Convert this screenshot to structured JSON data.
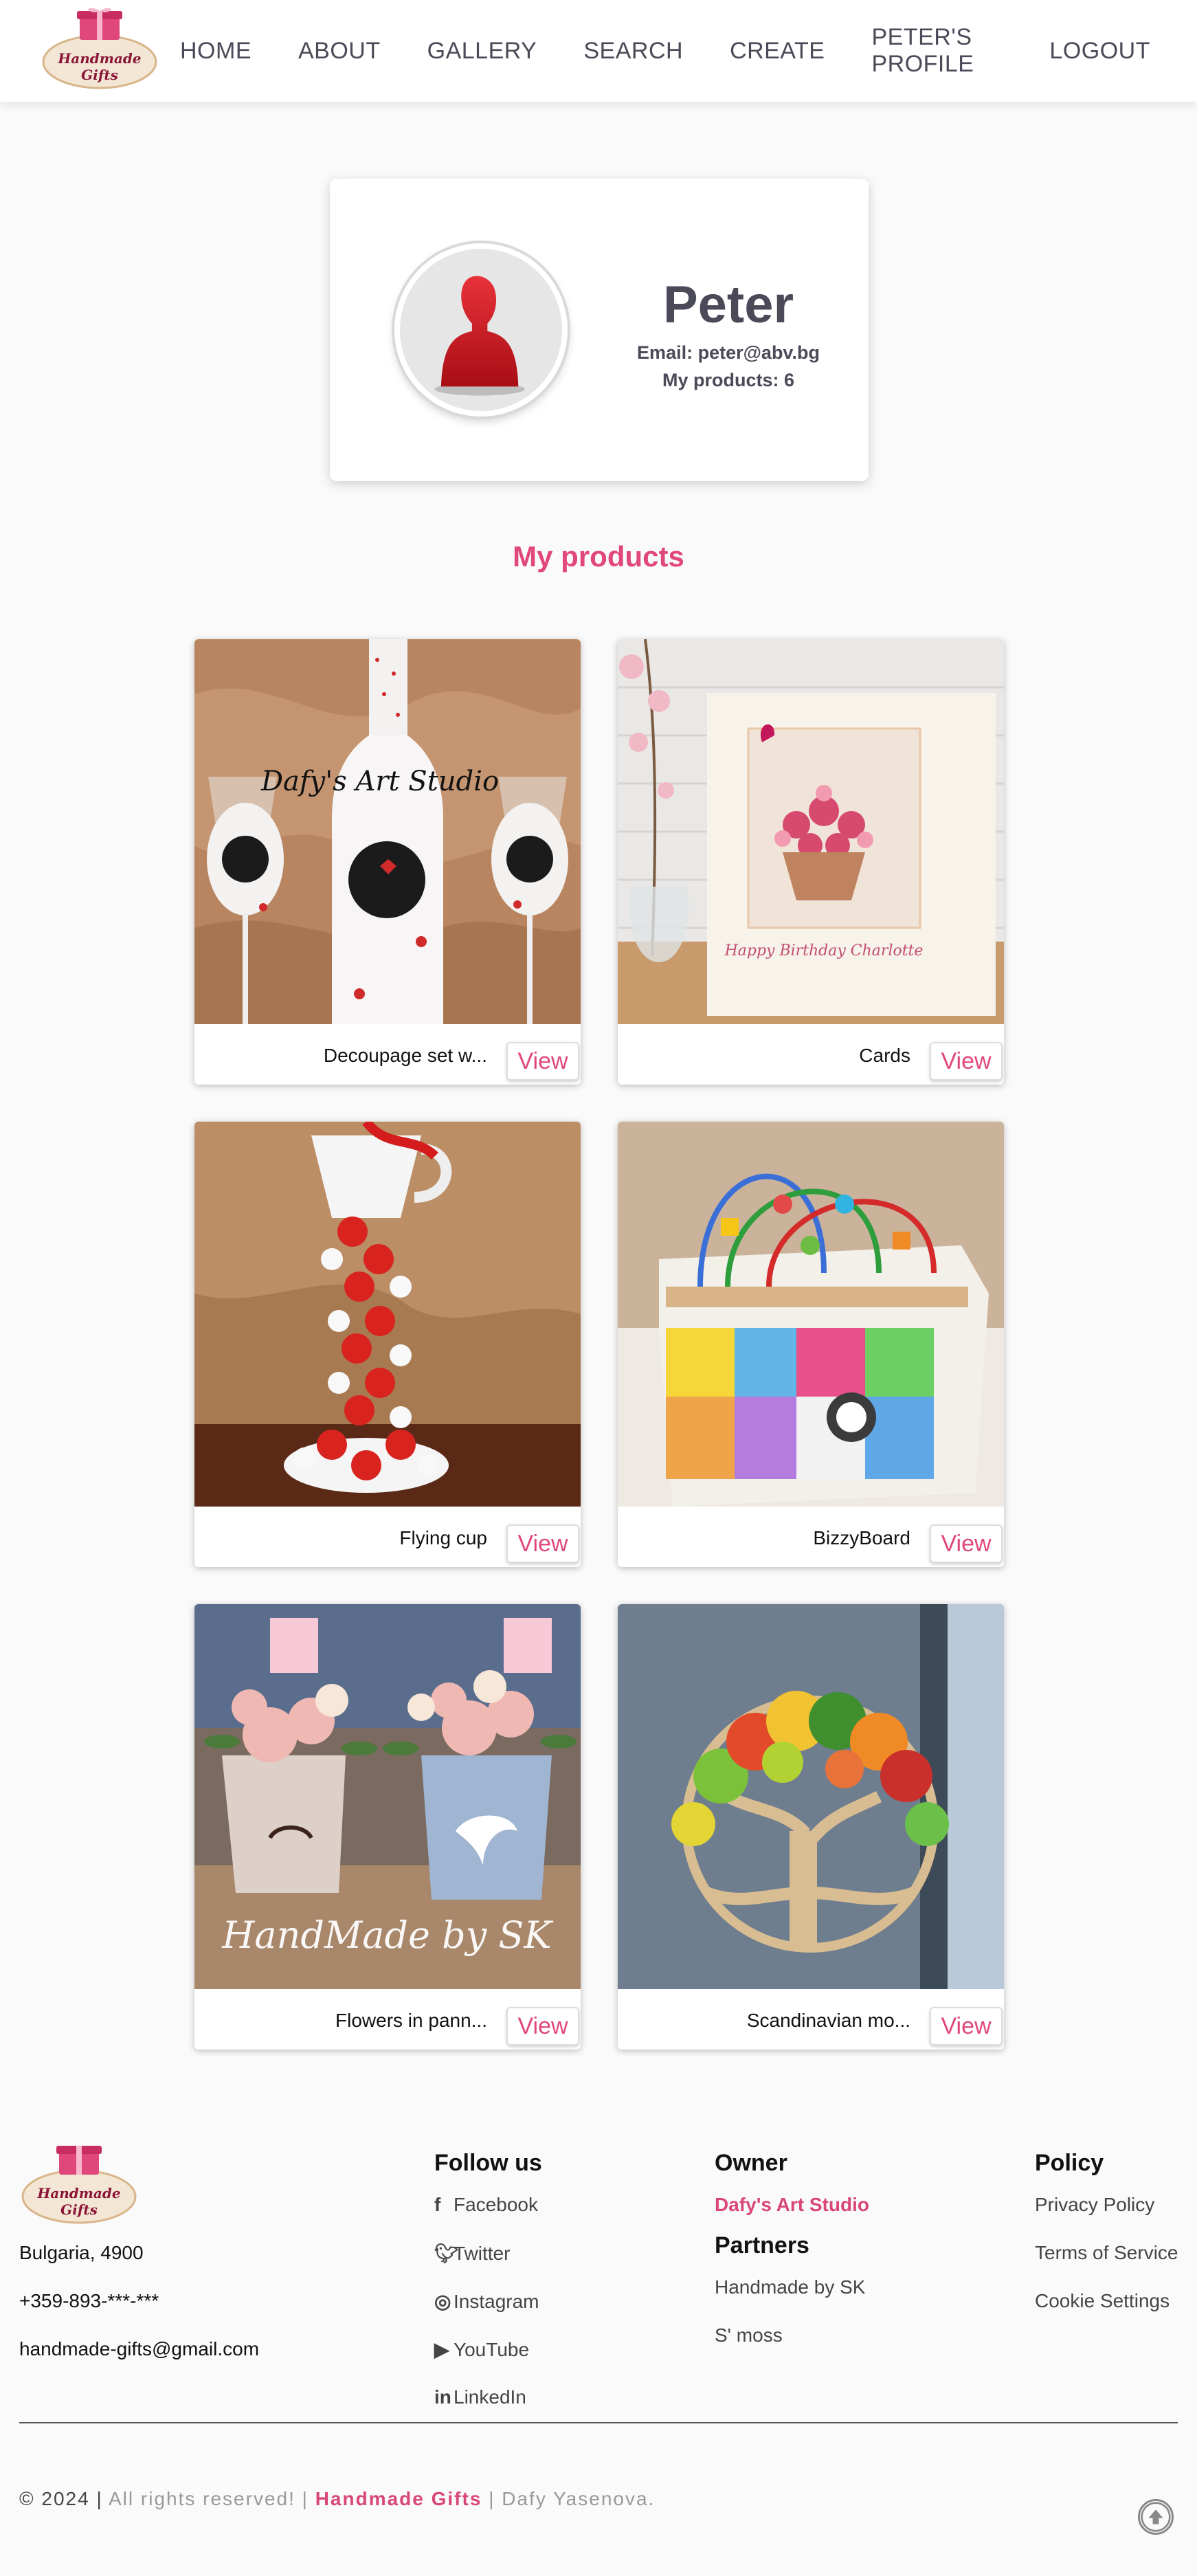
{
  "header": {
    "logo_text_line1": "Handmade",
    "logo_text_line2": "Gifts",
    "nav": [
      {
        "label": "HOME"
      },
      {
        "label": "ABOUT"
      },
      {
        "label": "GALLERY"
      },
      {
        "label": "SEARCH"
      },
      {
        "label": "CREATE"
      },
      {
        "label": "PETER'S PROFILE"
      },
      {
        "label": "LOGOUT"
      }
    ]
  },
  "profile": {
    "name": "Peter",
    "email": "Email: peter@abv.bg",
    "products_count": "My products: 6",
    "avatar_icon": "user-silhouette-icon"
  },
  "products_section": {
    "title": "My products",
    "view_label": "View",
    "items": [
      {
        "title": "Decoupage set w...",
        "image_caption": "Dafy's Art Studio"
      },
      {
        "title": "Cards",
        "image_caption": "Happy Birthday Charlotte"
      },
      {
        "title": "Flying cup",
        "image_caption": ""
      },
      {
        "title": "BizzyBoard",
        "image_caption": ""
      },
      {
        "title": "Flowers in pann...",
        "image_caption": "HandMade by SK"
      },
      {
        "title": "Scandinavian mo...",
        "image_caption": ""
      }
    ]
  },
  "footer": {
    "address": "Bulgaria, 4900",
    "phone": "+359-893-***-***",
    "email": "handmade-gifts@gmail.com",
    "follow_title": "Follow us",
    "social": [
      {
        "label": "Facebook",
        "icon": "facebook-icon"
      },
      {
        "label": "Twitter",
        "icon": "twitter-icon"
      },
      {
        "label": "Instagram",
        "icon": "instagram-icon"
      },
      {
        "label": "YouTube",
        "icon": "youtube-icon"
      },
      {
        "label": "LinkedIn",
        "icon": "linkedin-icon"
      }
    ],
    "owner_title": "Owner",
    "owner_name": "Dafy's Art Studio",
    "partners_title": "Partners",
    "partners": [
      "Handmade by SK",
      "S' moss"
    ],
    "policy_title": "Policy",
    "policy_links": [
      "Privacy Policy",
      "Terms of Service",
      "Cookie Settings"
    ],
    "copyright_year": "© 2024 |",
    "rights": "All rights reserved! |",
    "brand": "Handmade Gifts",
    "author": "| Dafy Yasenova."
  },
  "colors": {
    "accent": "#e0477a",
    "nav_text": "#4a4a58"
  }
}
